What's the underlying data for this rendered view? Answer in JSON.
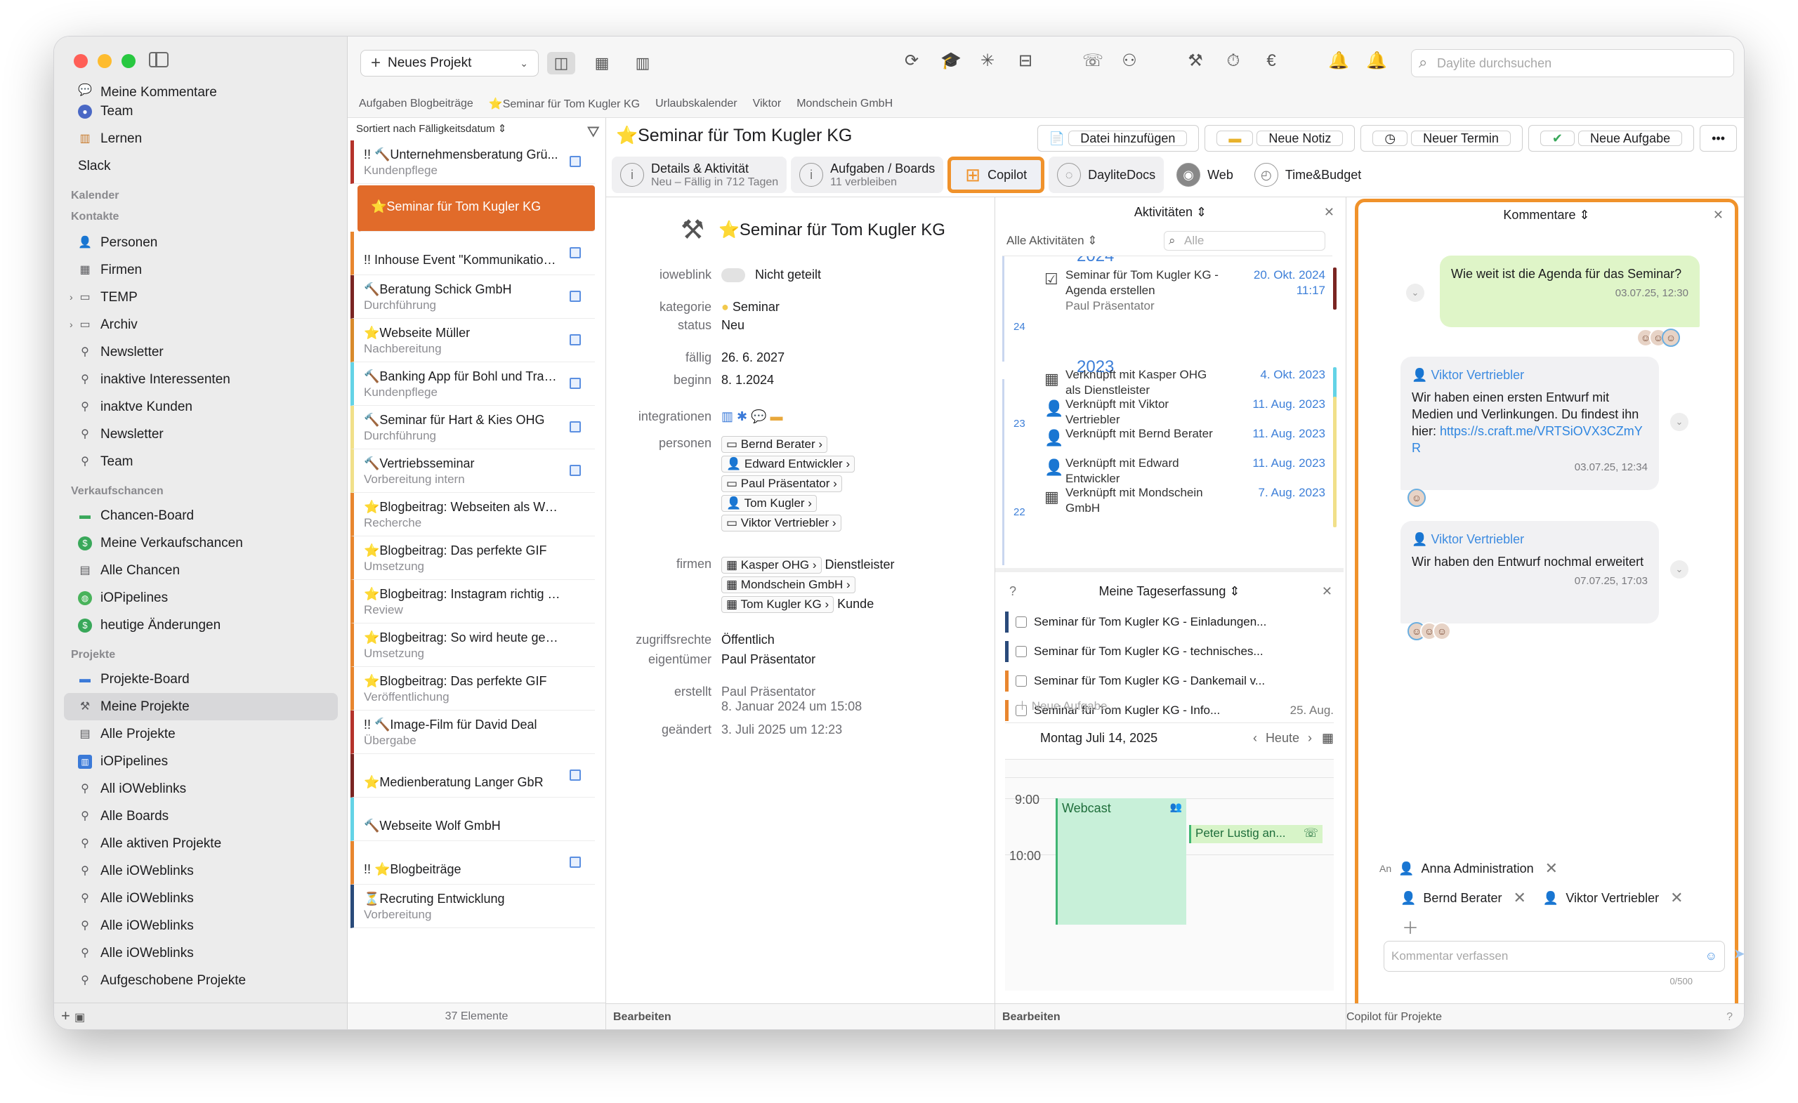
{
  "sidebar": {
    "top_items": [
      {
        "label": "Meine Kommentare",
        "icon": "comment-icon"
      },
      {
        "label": "Team",
        "icon": "team-icon"
      },
      {
        "label": "Lernen",
        "icon": "books-icon"
      },
      {
        "label": "Slack",
        "icon": "slack-icon"
      }
    ],
    "sections": {
      "kalender": "Kalender",
      "kontakte": "Kontakte",
      "verkaufschancen": "Verkaufschancen",
      "projekte": "Projekte"
    },
    "kontakte_items": [
      {
        "label": "Personen"
      },
      {
        "label": "Firmen"
      },
      {
        "label": "TEMP"
      },
      {
        "label": "Archiv"
      },
      {
        "label": "Newsletter"
      },
      {
        "label": "inaktive Interessenten"
      },
      {
        "label": "inaktve Kunden"
      },
      {
        "label": "Newsletter"
      },
      {
        "label": "Team"
      }
    ],
    "verkauf_items": [
      {
        "label": "Chancen-Board"
      },
      {
        "label": "Meine Verkaufschancen"
      },
      {
        "label": "Alle Chancen"
      },
      {
        "label": "iOPipelines"
      },
      {
        "label": "heutige Änderungen"
      }
    ],
    "projekt_items": [
      {
        "label": "Projekte-Board"
      },
      {
        "label": "Meine Projekte"
      },
      {
        "label": "Alle Projekte"
      },
      {
        "label": "iOPipelines"
      },
      {
        "label": "All iOWeblinks"
      },
      {
        "label": "Alle Boards"
      },
      {
        "label": "Alle aktiven Projekte"
      },
      {
        "label": "Alle iOWeblinks"
      },
      {
        "label": "Alle iOWeblinks"
      },
      {
        "label": "Alle iOWeblinks"
      },
      {
        "label": "Alle iOWeblinks"
      },
      {
        "label": "Aufgeschobene Projekte"
      }
    ]
  },
  "toolbar": {
    "new_project": "Neues Projekt",
    "search_placeholder": "Daylite durchsuchen"
  },
  "breadcrumbs": [
    "Aufgaben Blogbeiträge",
    "⭐Seminar für Tom Kugler KG",
    "Urlaubskalender",
    "Viktor",
    "Mondschein GmbH"
  ],
  "list": {
    "sort_label": "Sortiert nach Fälligkeitsdatum",
    "footer": "37 Elemente",
    "cards": [
      {
        "title": "!! 🔨Unternehmensberatung Grü...",
        "sub": "Kundenpflege",
        "color": "#b5332b",
        "badge": true
      },
      {
        "title": "⭐Seminar für Tom Kugler KG",
        "sub": "",
        "color": "#e16b2a",
        "active": true
      },
      {
        "title": "!! Inhouse Event \"Kommunikation...",
        "sub": "",
        "color": "#e8862f",
        "badge": true
      },
      {
        "title": "🔨Beratung Schick GmbH",
        "sub": "Durchführung",
        "color": "#7a2522",
        "badge": true
      },
      {
        "title": "⭐Webseite Müller",
        "sub": "Nachbereitung",
        "color": "#d88a2c",
        "badge": true
      },
      {
        "title": "🔨Banking App für Bohl und Trau...",
        "sub": "Kundenpflege",
        "color": "#64d3e6",
        "badge": true
      },
      {
        "title": "🔨Seminar für Hart & Kies OHG",
        "sub": "Durchführung",
        "color": "#f1e08a",
        "badge": true
      },
      {
        "title": "🔨Vertriebsseminar",
        "sub": "Vorbereitung intern",
        "color": "#f1e08a",
        "badge": true
      },
      {
        "title": "⭐Blogbeitrag: Webseiten als Wegw...",
        "sub": "Recherche",
        "color": "#e8862f",
        "badge": false
      },
      {
        "title": "⭐Blogbeitrag: Das perfekte GIF",
        "sub": "Umsetzung",
        "color": "#e8862f",
        "badge": false
      },
      {
        "title": "⭐Blogbeitrag: Instagram richtig nut...",
        "sub": "Review",
        "color": "#e8862f",
        "badge": false
      },
      {
        "title": "⭐Blogbeitrag: So wird heute gepostet",
        "sub": "Umsetzung",
        "color": "#e8862f",
        "badge": false
      },
      {
        "title": "⭐Blogbeitrag: Das perfekte GIF",
        "sub": "Veröffentlichung",
        "color": "#e8862f",
        "badge": false
      },
      {
        "title": "!! 🔨Image-Film für David Deal",
        "sub": "Übergabe",
        "color": "#b5332b",
        "badge": false
      },
      {
        "title": "⭐Medienberatung Langer GbR",
        "sub": "",
        "color": "#7a2522",
        "badge": true
      },
      {
        "title": "🔨Webseite Wolf GmbH",
        "sub": "",
        "color": "#64d3e6",
        "badge": false
      },
      {
        "title": "!! ⭐Blogbeiträge",
        "sub": "",
        "color": "#e8862f",
        "badge": true
      },
      {
        "title": "⏳Recruting Entwicklung",
        "sub": "Vorbereitung",
        "color": "#2a4a7a",
        "badge": false
      }
    ]
  },
  "detail": {
    "title": "⭐Seminar für Tom Kugler KG",
    "buttons": [
      "Datei hinzufügen",
      "Neue Notiz",
      "Neuer Termin",
      "Neue Aufgabe",
      "•••"
    ],
    "tabs": [
      {
        "label": "Details & Aktivität",
        "sub": "Neu – Fällig in 712 Tagen"
      },
      {
        "label": "Aufgaben / Boards",
        "sub": "11 verbleiben"
      },
      {
        "label": "Copilot",
        "sub": ""
      },
      {
        "label": "DayliteDocs",
        "sub": ""
      },
      {
        "label": "Web",
        "sub": ""
      },
      {
        "label": "Time&Budget",
        "sub": ""
      }
    ],
    "record_title": "⭐Seminar für Tom Kugler KG",
    "fields": {
      "ioweblink_k": "ioweblink",
      "ioweblink_v": "Nicht geteilt",
      "kategorie_k": "kategorie",
      "kategorie_v": "Seminar",
      "status_k": "status",
      "status_v": "Neu",
      "faellig_k": "fällig",
      "faellig_v": "26.  6. 2027",
      "beginn_k": "beginn",
      "beginn_v": "8.  1.2024",
      "integrationen_k": "integrationen",
      "personen_k": "personen",
      "personen": [
        "Bernd Berater",
        "Edward Entwickler",
        "Paul Präsentator",
        "Tom Kugler",
        "Viktor Vertriebler"
      ],
      "firmen_k": "firmen",
      "firmen": [
        {
          "name": "Kasper OHG",
          "role": "Dienstleister"
        },
        {
          "name": "Mondschein GmbH",
          "role": ""
        },
        {
          "name": "Tom Kugler KG",
          "role": "Kunde"
        }
      ],
      "zugriff_k": "zugriffsrechte",
      "zugriff_v": "Öffentlich",
      "eigentuemer_k": "eigentümer",
      "eigentuemer_v": "Paul Präsentator",
      "erstellt_k": "erstellt",
      "erstellt_v1": "Paul Präsentator",
      "erstellt_v2": "8. Januar 2024 um 15:08",
      "geaendert_k": "geändert",
      "geaendert_v": "3. Juli 2025 um 12:23"
    },
    "footer": "Bearbeiten"
  },
  "activities": {
    "title": "Aktivitäten",
    "filter": "Alle Aktivitäten",
    "search_placeholder": "Alle",
    "year_top": "2024",
    "year": "2023",
    "rows": [
      {
        "text": "Seminar für Tom Kugler KG - Agenda erstellen",
        "sub": "Paul Präsentator",
        "date": "20. Okt. 2024",
        "time": "11:17",
        "color": "#7a2522",
        "day": "24"
      },
      {
        "text": "Verknüpft mit Kasper OHG als Dienstleister",
        "sub": "",
        "date": "4. Okt. 2023",
        "time": "",
        "color": "#64d3e6",
        "day": ""
      },
      {
        "text": "Verknüpft mit Viktor Vertriebler",
        "sub": "",
        "date": "11. Aug. 2023",
        "time": "",
        "color": "#f1e08a",
        "day": "23"
      },
      {
        "text": "Verknüpft mit Bernd Berater",
        "sub": "",
        "date": "11. Aug. 2023",
        "time": "",
        "color": "#f1e08a",
        "day": ""
      },
      {
        "text": "Verknüpft mit Edward Entwickler",
        "sub": "",
        "date": "11. Aug. 2023",
        "time": "",
        "color": "#f1e08a",
        "day": ""
      },
      {
        "text": "Verknüpft mit Mondschein GmbH",
        "sub": "",
        "date": "7. Aug. 2023",
        "time": "",
        "color": "#f1e08a",
        "day": "22"
      }
    ]
  },
  "tageserfassung": {
    "help": "?",
    "title": "Meine Tageserfassung",
    "rows": [
      {
        "text": "Seminar für Tom Kugler KG - Einladungen...",
        "date": "",
        "color": "#2a4a7a"
      },
      {
        "text": "Seminar für Tom Kugler KG - technisches...",
        "date": "",
        "color": "#2a4a7a"
      },
      {
        "text": "Seminar für Tom Kugler KG - Dankemail v...",
        "date": "",
        "color": "#e8862f"
      },
      {
        "text": "Seminar für Tom Kugler KG - Info...",
        "date": "25. Aug.",
        "color": "#e8862f"
      }
    ],
    "new_task": "Neue Aufgabe ..."
  },
  "calendar": {
    "date": "Montag Juli 14, 2025",
    "today": "Heute",
    "times": [
      "9:00",
      "10:00"
    ],
    "events": [
      {
        "name": "Webcast"
      },
      {
        "name": "Peter Lustig an..."
      }
    ]
  },
  "comments": {
    "title": "Kommentare",
    "messages": [
      {
        "author": "",
        "text": "Wie weit ist die Agenda für das Seminar?",
        "time": "03.07.25, 12:30"
      },
      {
        "author": "Viktor Vertriebler",
        "text": "Wir haben einen ersten Entwurf mit Medien und Verlinkungen. Du findest ihn hier:",
        "link": "https://s.craft.me/VRTSiOVX3CZmYR",
        "time": "03.07.25, 12:34"
      },
      {
        "author": "Viktor Vertriebler",
        "text": "Wir haben den Entwurf nochmal erweitert",
        "time": "07.07.25, 17:03"
      }
    ],
    "to_label": "An",
    "recipients": [
      "Anna Administration",
      "Bernd Berater",
      "Viktor Vertriebler"
    ],
    "placeholder": "Kommentar verfassen",
    "counter": "0/500"
  },
  "copilot_footer": "Copilot für Projekte",
  "colors": {
    "accent": "#f0922b",
    "selected_card": "#e16b2a",
    "link": "#3d8be0",
    "bubble_green": "#dff5c8"
  }
}
